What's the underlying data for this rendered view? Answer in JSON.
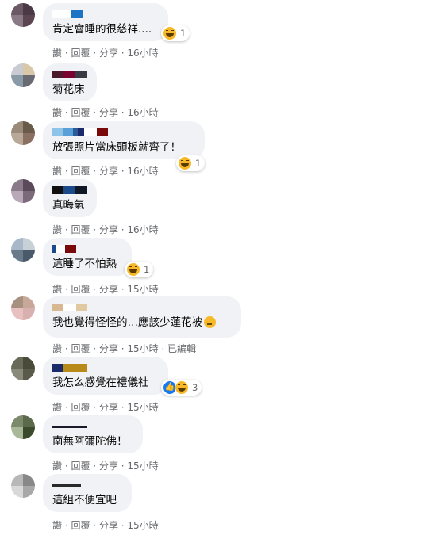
{
  "actions": {
    "like": "讚",
    "reply": "回覆",
    "share": "分享",
    "separator": " · ",
    "edited": "已編輯"
  },
  "comments": [
    {
      "text": "肯定會睡的很慈祥....",
      "time": "16小時",
      "reaction_count": "1"
    },
    {
      "text": "菊花床",
      "time": "16小時"
    },
    {
      "text": "放張照片當床頭板就齊了！",
      "time": "16小時",
      "reaction_count": "1"
    },
    {
      "text": "真晦氣",
      "time": "16小時"
    },
    {
      "text": "這睡了不怕熱",
      "time": "15小時",
      "reaction_count": "1"
    },
    {
      "text": "我也覺得怪怪的…應該少蓮花被",
      "time": "15小時"
    },
    {
      "text": "我怎么感覺在禮儀社",
      "time": "15小時",
      "reaction_count": "3"
    },
    {
      "text": "南無阿彌陀佛！",
      "time": "15小時"
    },
    {
      "text": "這組不便宜吧",
      "time": "15小時"
    }
  ],
  "icons": {
    "haha": "haha-reaction-icon",
    "like": "like-reaction-icon",
    "thinking": "thinking-emoji-icon"
  },
  "colors": {
    "bubble": "#f0f2f5",
    "meta_text": "#65676b",
    "haha": "#f7b928",
    "like": "#1877f2"
  }
}
